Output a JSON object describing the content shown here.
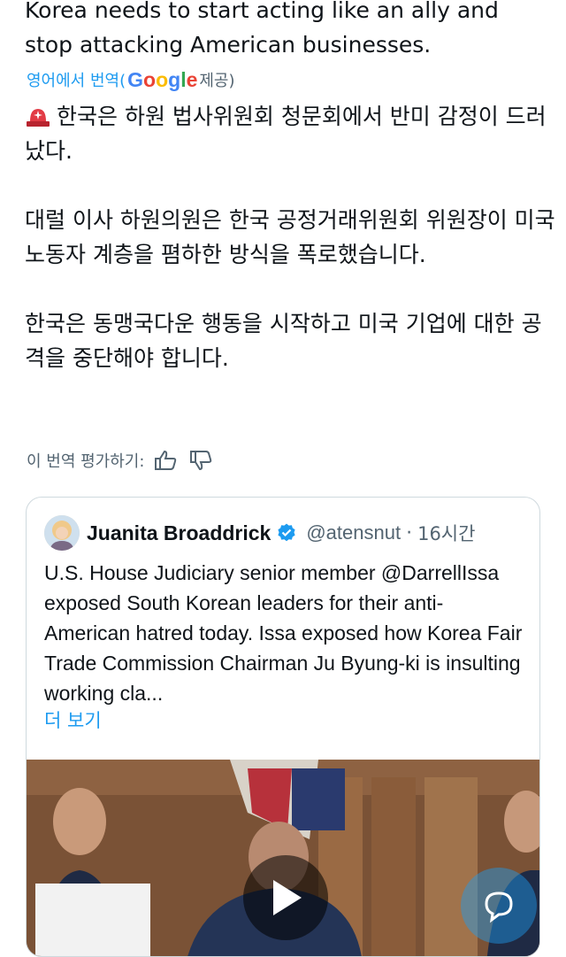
{
  "original_tweet": {
    "text": "Korea needs to start acting like an ally and\nstop attacking American businesses."
  },
  "translation": {
    "from_label": "영어에서 번역(",
    "provider": "Google",
    "provider_suffix": " 제공)",
    "paragraphs": [
      "한국은 하원 법사위원회 청문회에서 반미 감정이 드러났다.",
      "대럴 이사 하원의원은 한국 공정거래위원회 위원장이 미국 노동자 계층을 폄하한 방식을 폭로했습니다.",
      "한국은 동맹국다운 행동을 시작하고 미국 기업에 대한 공격을 중단해야 합니다."
    ],
    "rate_label": "이 번역 평가하기:"
  },
  "quoted_tweet": {
    "author_name": "Juanita Broaddrick",
    "handle": "@atensnut",
    "separator": "·",
    "time": "16시간",
    "text": "U.S. House Judiciary senior member @DarrellIssa exposed South Korean leaders for their anti-American hatred today. Issa exposed how Korea Fair Trade Commission Chairman Ju Byung-ki is insulting working cla...",
    "show_more_label": "더 보기"
  },
  "icons": {
    "siren": "siren-icon",
    "thumbs_up": "thumbs-up-icon",
    "thumbs_down": "thumbs-down-icon",
    "verified": "verified-badge-icon",
    "play": "play-icon",
    "compose": "chat-bubble-icon"
  },
  "colors": {
    "accent": "#1d9bf0",
    "text": "#0f1419",
    "secondary": "#536471"
  }
}
